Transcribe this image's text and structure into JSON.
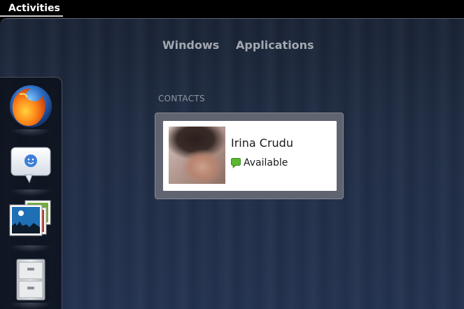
{
  "top_panel": {
    "activities_label": "Activities"
  },
  "overview": {
    "tabs": [
      {
        "label": "Windows"
      },
      {
        "label": "Applications"
      }
    ]
  },
  "dash": {
    "items": [
      {
        "icon": "firefox-icon"
      },
      {
        "icon": "empathy-chat-icon"
      },
      {
        "icon": "photo-viewer-icon"
      },
      {
        "icon": "file-cabinet-icon"
      }
    ]
  },
  "contacts": {
    "section_title": "CONTACTS",
    "items": [
      {
        "name": "Irina Crudu",
        "status": "Available",
        "status_color": "#5cb831"
      }
    ]
  },
  "colors": {
    "panel_bg": "#000000",
    "overview_bg": "#1f2c42",
    "tab_text": "#a3a8b0",
    "section_title": "#8f96a2",
    "contact_frame": "#5f6470"
  }
}
